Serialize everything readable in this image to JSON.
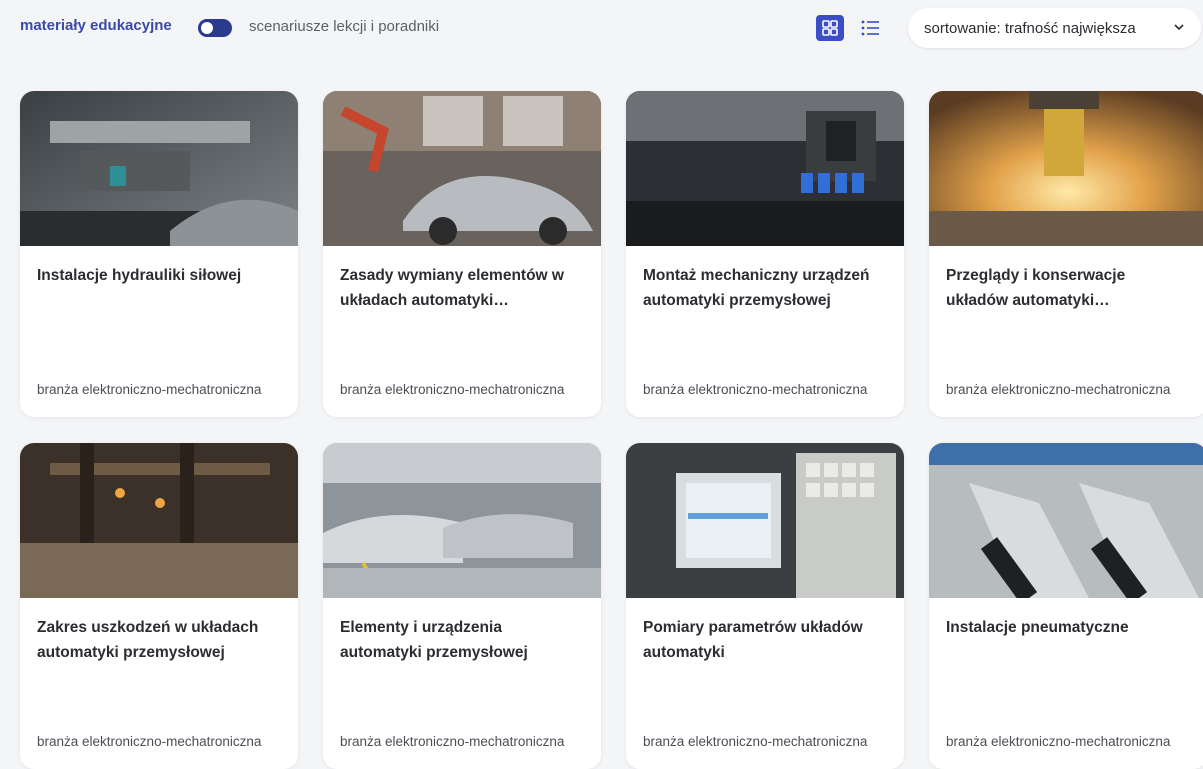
{
  "toolbar": {
    "toggle_left_label": "materiały edukacyjne",
    "toggle_right_label": "scenariusze lekcji i poradniki",
    "sort_label": "sortowanie: trafność największa",
    "accent_color": "#3b4ec8"
  },
  "cards": [
    {
      "title": "Instalacje hydrauliki siłowej",
      "category": "branża elektroniczno-mechatroniczna"
    },
    {
      "title": "Zasady wymiany elementów w układach automatyki…",
      "category": "branża elektroniczno-mechatroniczna"
    },
    {
      "title": "Montaż mechaniczny urządzeń automatyki przemysłowej",
      "category": "branża elektroniczno-mechatroniczna"
    },
    {
      "title": "Przeglądy i konserwacje układów automatyki…",
      "category": "branża elektroniczno-mechatroniczna"
    },
    {
      "title": "Zakres uszkodzeń w układach automatyki przemysłowej",
      "category": "branża elektroniczno-mechatroniczna"
    },
    {
      "title": "Elementy i urządzenia automatyki przemysłowej",
      "category": "branża elektroniczno-mechatroniczna"
    },
    {
      "title": "Pomiary parametrów układów automatyki",
      "category": "branża elektroniczno-mechatroniczna"
    },
    {
      "title": "Instalacje pneumatyczne",
      "category": "branża elektroniczno-mechatroniczna"
    }
  ]
}
